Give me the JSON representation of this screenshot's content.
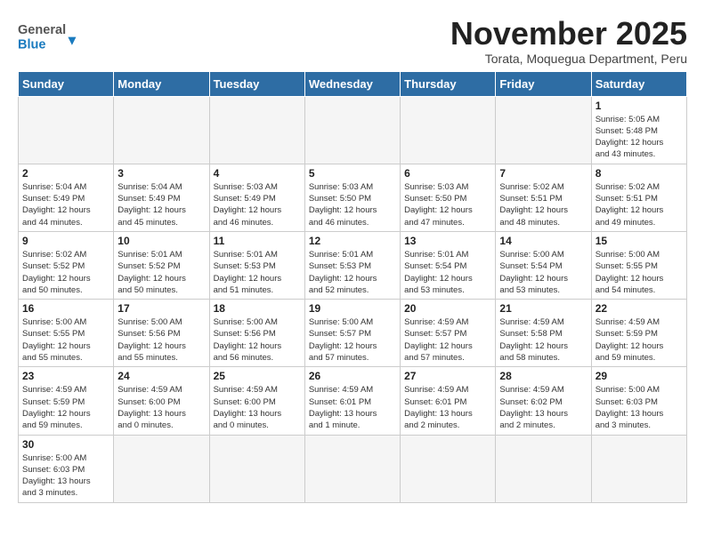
{
  "header": {
    "logo_general": "General",
    "logo_blue": "Blue",
    "month_year": "November 2025",
    "location": "Torata, Moquegua Department, Peru"
  },
  "days_of_week": [
    "Sunday",
    "Monday",
    "Tuesday",
    "Wednesday",
    "Thursday",
    "Friday",
    "Saturday"
  ],
  "weeks": [
    [
      {
        "day": "",
        "info": ""
      },
      {
        "day": "",
        "info": ""
      },
      {
        "day": "",
        "info": ""
      },
      {
        "day": "",
        "info": ""
      },
      {
        "day": "",
        "info": ""
      },
      {
        "day": "",
        "info": ""
      },
      {
        "day": "1",
        "info": "Sunrise: 5:05 AM\nSunset: 5:48 PM\nDaylight: 12 hours\nand 43 minutes."
      }
    ],
    [
      {
        "day": "2",
        "info": "Sunrise: 5:04 AM\nSunset: 5:49 PM\nDaylight: 12 hours\nand 44 minutes."
      },
      {
        "day": "3",
        "info": "Sunrise: 5:04 AM\nSunset: 5:49 PM\nDaylight: 12 hours\nand 45 minutes."
      },
      {
        "day": "4",
        "info": "Sunrise: 5:03 AM\nSunset: 5:49 PM\nDaylight: 12 hours\nand 46 minutes."
      },
      {
        "day": "5",
        "info": "Sunrise: 5:03 AM\nSunset: 5:50 PM\nDaylight: 12 hours\nand 46 minutes."
      },
      {
        "day": "6",
        "info": "Sunrise: 5:03 AM\nSunset: 5:50 PM\nDaylight: 12 hours\nand 47 minutes."
      },
      {
        "day": "7",
        "info": "Sunrise: 5:02 AM\nSunset: 5:51 PM\nDaylight: 12 hours\nand 48 minutes."
      },
      {
        "day": "8",
        "info": "Sunrise: 5:02 AM\nSunset: 5:51 PM\nDaylight: 12 hours\nand 49 minutes."
      }
    ],
    [
      {
        "day": "9",
        "info": "Sunrise: 5:02 AM\nSunset: 5:52 PM\nDaylight: 12 hours\nand 50 minutes."
      },
      {
        "day": "10",
        "info": "Sunrise: 5:01 AM\nSunset: 5:52 PM\nDaylight: 12 hours\nand 50 minutes."
      },
      {
        "day": "11",
        "info": "Sunrise: 5:01 AM\nSunset: 5:53 PM\nDaylight: 12 hours\nand 51 minutes."
      },
      {
        "day": "12",
        "info": "Sunrise: 5:01 AM\nSunset: 5:53 PM\nDaylight: 12 hours\nand 52 minutes."
      },
      {
        "day": "13",
        "info": "Sunrise: 5:01 AM\nSunset: 5:54 PM\nDaylight: 12 hours\nand 53 minutes."
      },
      {
        "day": "14",
        "info": "Sunrise: 5:00 AM\nSunset: 5:54 PM\nDaylight: 12 hours\nand 53 minutes."
      },
      {
        "day": "15",
        "info": "Sunrise: 5:00 AM\nSunset: 5:55 PM\nDaylight: 12 hours\nand 54 minutes."
      }
    ],
    [
      {
        "day": "16",
        "info": "Sunrise: 5:00 AM\nSunset: 5:55 PM\nDaylight: 12 hours\nand 55 minutes."
      },
      {
        "day": "17",
        "info": "Sunrise: 5:00 AM\nSunset: 5:56 PM\nDaylight: 12 hours\nand 55 minutes."
      },
      {
        "day": "18",
        "info": "Sunrise: 5:00 AM\nSunset: 5:56 PM\nDaylight: 12 hours\nand 56 minutes."
      },
      {
        "day": "19",
        "info": "Sunrise: 5:00 AM\nSunset: 5:57 PM\nDaylight: 12 hours\nand 57 minutes."
      },
      {
        "day": "20",
        "info": "Sunrise: 4:59 AM\nSunset: 5:57 PM\nDaylight: 12 hours\nand 57 minutes."
      },
      {
        "day": "21",
        "info": "Sunrise: 4:59 AM\nSunset: 5:58 PM\nDaylight: 12 hours\nand 58 minutes."
      },
      {
        "day": "22",
        "info": "Sunrise: 4:59 AM\nSunset: 5:59 PM\nDaylight: 12 hours\nand 59 minutes."
      }
    ],
    [
      {
        "day": "23",
        "info": "Sunrise: 4:59 AM\nSunset: 5:59 PM\nDaylight: 12 hours\nand 59 minutes."
      },
      {
        "day": "24",
        "info": "Sunrise: 4:59 AM\nSunset: 6:00 PM\nDaylight: 13 hours\nand 0 minutes."
      },
      {
        "day": "25",
        "info": "Sunrise: 4:59 AM\nSunset: 6:00 PM\nDaylight: 13 hours\nand 0 minutes."
      },
      {
        "day": "26",
        "info": "Sunrise: 4:59 AM\nSunset: 6:01 PM\nDaylight: 13 hours\nand 1 minute."
      },
      {
        "day": "27",
        "info": "Sunrise: 4:59 AM\nSunset: 6:01 PM\nDaylight: 13 hours\nand 2 minutes."
      },
      {
        "day": "28",
        "info": "Sunrise: 4:59 AM\nSunset: 6:02 PM\nDaylight: 13 hours\nand 2 minutes."
      },
      {
        "day": "29",
        "info": "Sunrise: 5:00 AM\nSunset: 6:03 PM\nDaylight: 13 hours\nand 3 minutes."
      }
    ],
    [
      {
        "day": "30",
        "info": "Sunrise: 5:00 AM\nSunset: 6:03 PM\nDaylight: 13 hours\nand 3 minutes."
      },
      {
        "day": "",
        "info": ""
      },
      {
        "day": "",
        "info": ""
      },
      {
        "day": "",
        "info": ""
      },
      {
        "day": "",
        "info": ""
      },
      {
        "day": "",
        "info": ""
      },
      {
        "day": "",
        "info": ""
      }
    ]
  ]
}
